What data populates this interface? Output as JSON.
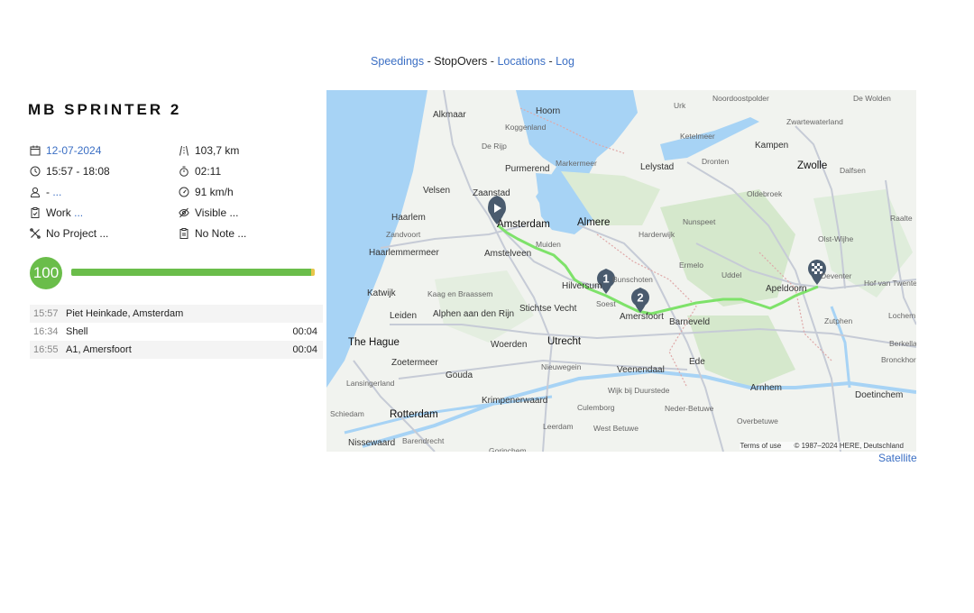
{
  "nav": {
    "speedings": "Speedings",
    "stopovers": "StopOvers",
    "locations": "Locations",
    "log": "Log",
    "sep": "-"
  },
  "trip": {
    "title": "MB SPRINTER 2",
    "date": "12-07-2024",
    "time_range": "15:57 - 18:08",
    "driver_prefix": "-",
    "driver_link": "...",
    "type": "Work",
    "type_link": "...",
    "project": "No Project ...",
    "distance": "103,7 km",
    "duration": "02:11",
    "max_speed": "91 km/h",
    "visibility": "Visible ...",
    "note": "No Note ..."
  },
  "score": {
    "value": "100",
    "fraction": 0.985
  },
  "stops": [
    {
      "time": "15:57",
      "place": "Piet Heinkade, Amsterdam",
      "duration": ""
    },
    {
      "time": "16:34",
      "place": "Shell",
      "duration": "00:04"
    },
    {
      "time": "16:55",
      "place": "A1, Amersfoort",
      "duration": "00:04"
    }
  ],
  "map": {
    "places": [
      "Noordoostpolder",
      "De Wolden",
      "Alkmaar",
      "Hoorn",
      "Urk",
      "Zwartewaterland",
      "Koggenland",
      "Ketelmeer",
      "Kampen",
      "De Rijp",
      "Markermeer",
      "Lelystad",
      "Dronten",
      "Zwolle",
      "Purmerend",
      "Dalfsen",
      "Oldebroek",
      "Velsen",
      "Zaanstad",
      "Raalte",
      "Haarlem",
      "Amsterdam",
      "Almere",
      "Nunspeet",
      "Zandvoort",
      "Olst-Wijhe",
      "Muiden",
      "Harderwijk",
      "Haarlemmermeer",
      "Amstelveen",
      "Ermelo",
      "Deventer",
      "Bunschoten",
      "Uddel",
      "Hilversum",
      "Apeldoorn",
      "Hof van Twente",
      "Katwijk",
      "Kaag en Braassem",
      "Soest",
      "Amersfoort",
      "Leiden",
      "Alphen aan den Rijn",
      "Stichtse Vecht",
      "Barneveld",
      "Zutphen",
      "Lochem",
      "The Hague",
      "Woerden",
      "Utrecht",
      "Berkelland",
      "Zoetermeer",
      "Gouda",
      "Nieuwegein",
      "Veenendaal",
      "Ede",
      "Bronckhorst",
      "Lansingerland",
      "Wijk bij Duurstede",
      "Arnhem",
      "Doetinchem",
      "Krimpenerwaard",
      "Culemborg",
      "Neder-Betuwe",
      "Schiedam",
      "Rotterdam",
      "Leerdam",
      "Overbetuwe",
      "Nissewaard",
      "Barendrecht",
      "West Betuwe",
      "Gorinchem"
    ],
    "terms": "Terms of use",
    "copyright": "© 1987–2024 HERE, Deutschland",
    "marker1": "1",
    "marker2": "2",
    "satellite": "Satellite"
  }
}
